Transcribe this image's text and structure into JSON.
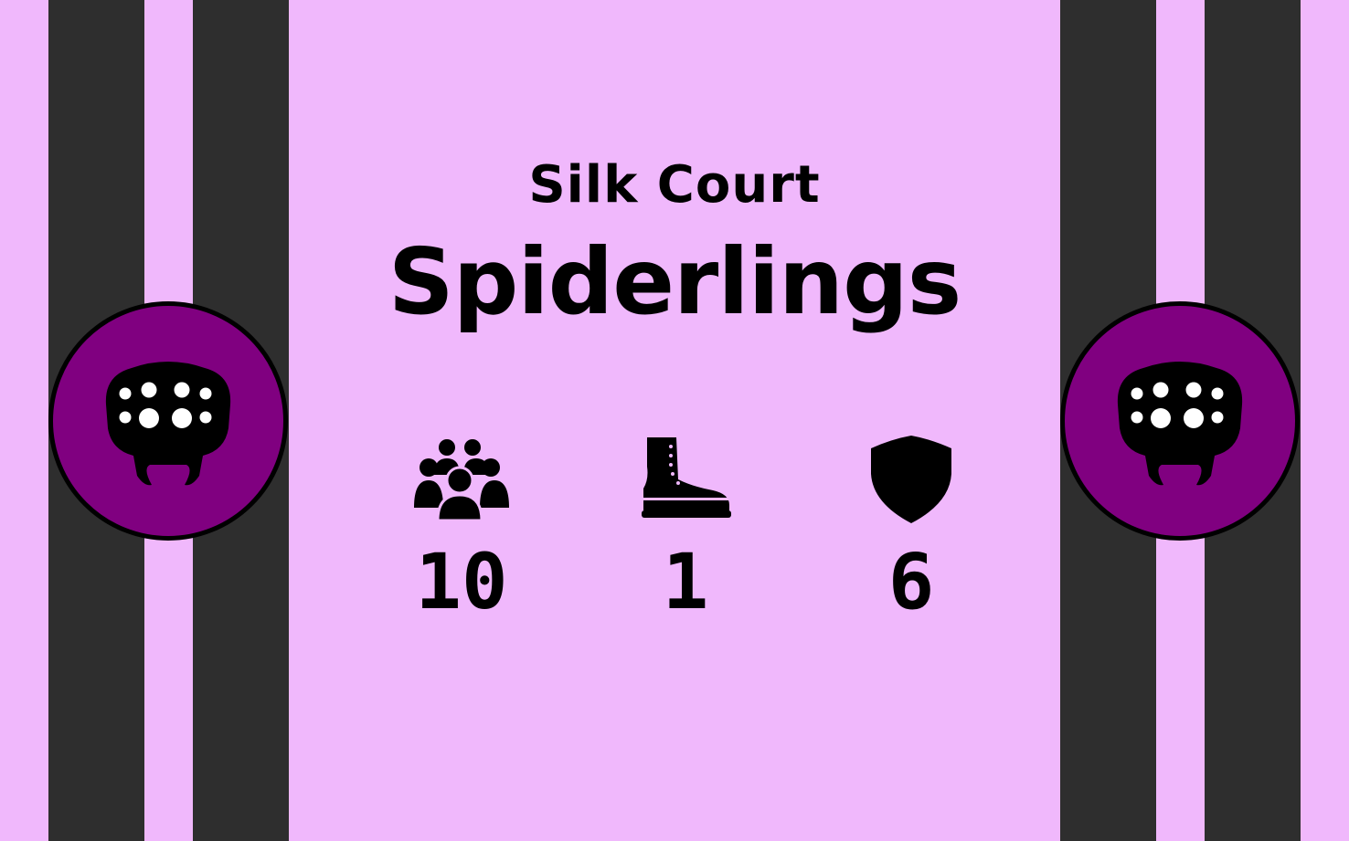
{
  "card": {
    "faction": "Silk Court",
    "unit_name": "Spiderlings",
    "colors": {
      "background": "#f0b8fc",
      "stripe": "#2e2e2e",
      "emblem": "#800080",
      "ink": "#000000"
    }
  },
  "emblem": {
    "icon": "spider-head-icon"
  },
  "stats": [
    {
      "icon": "group-icon",
      "value": "10"
    },
    {
      "icon": "boot-icon",
      "value": "1"
    },
    {
      "icon": "shield-icon",
      "value": "6"
    }
  ]
}
